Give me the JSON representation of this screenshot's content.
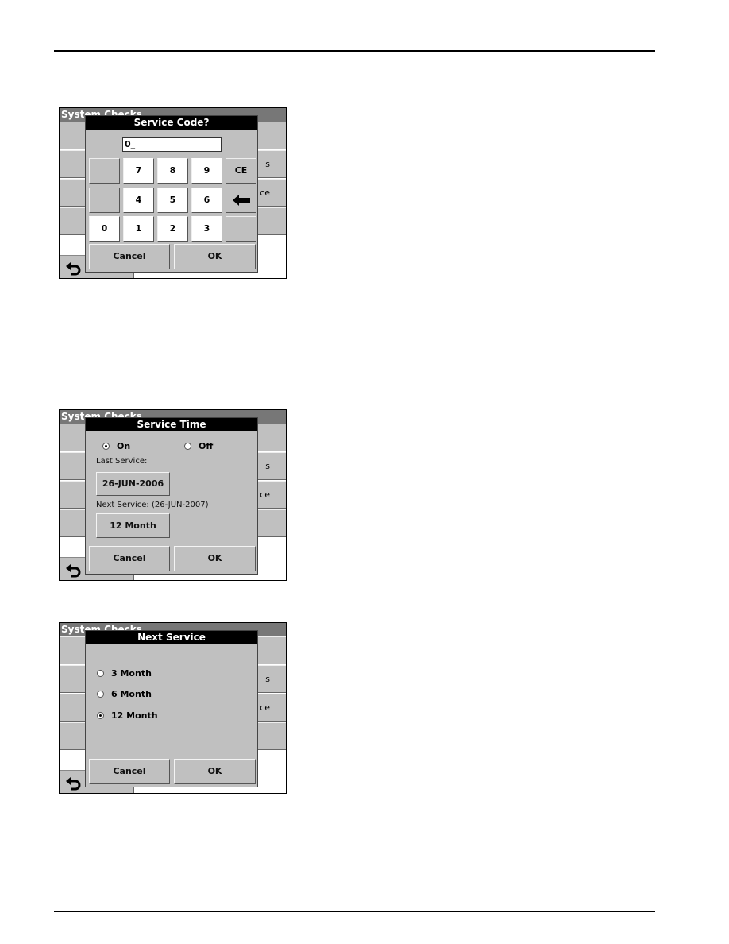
{
  "background_screen": {
    "title": "System Checks",
    "right_fragments": [
      "s",
      "ce"
    ]
  },
  "screen1": {
    "title": "Service Code?",
    "input_value": "0_",
    "keys": [
      "7",
      "8",
      "9",
      "CE",
      "4",
      "5",
      "6",
      "0",
      "1",
      "2",
      "3"
    ],
    "cancel": "Cancel",
    "ok": "OK"
  },
  "screen2": {
    "title": "Service Time",
    "radio_on": "On",
    "radio_off": "Off",
    "selected": "On",
    "last_service_label": "Last Service:",
    "last_service_value": "26-JUN-2006",
    "next_service_label": "Next Service: (26-JUN-2007)",
    "next_service_value": "12 Month",
    "cancel": "Cancel",
    "ok": "OK"
  },
  "screen3": {
    "title": "Next Service",
    "options": [
      "3 Month",
      "6 Month",
      "12 Month"
    ],
    "selected": "12 Month",
    "cancel": "Cancel",
    "ok": "OK"
  }
}
